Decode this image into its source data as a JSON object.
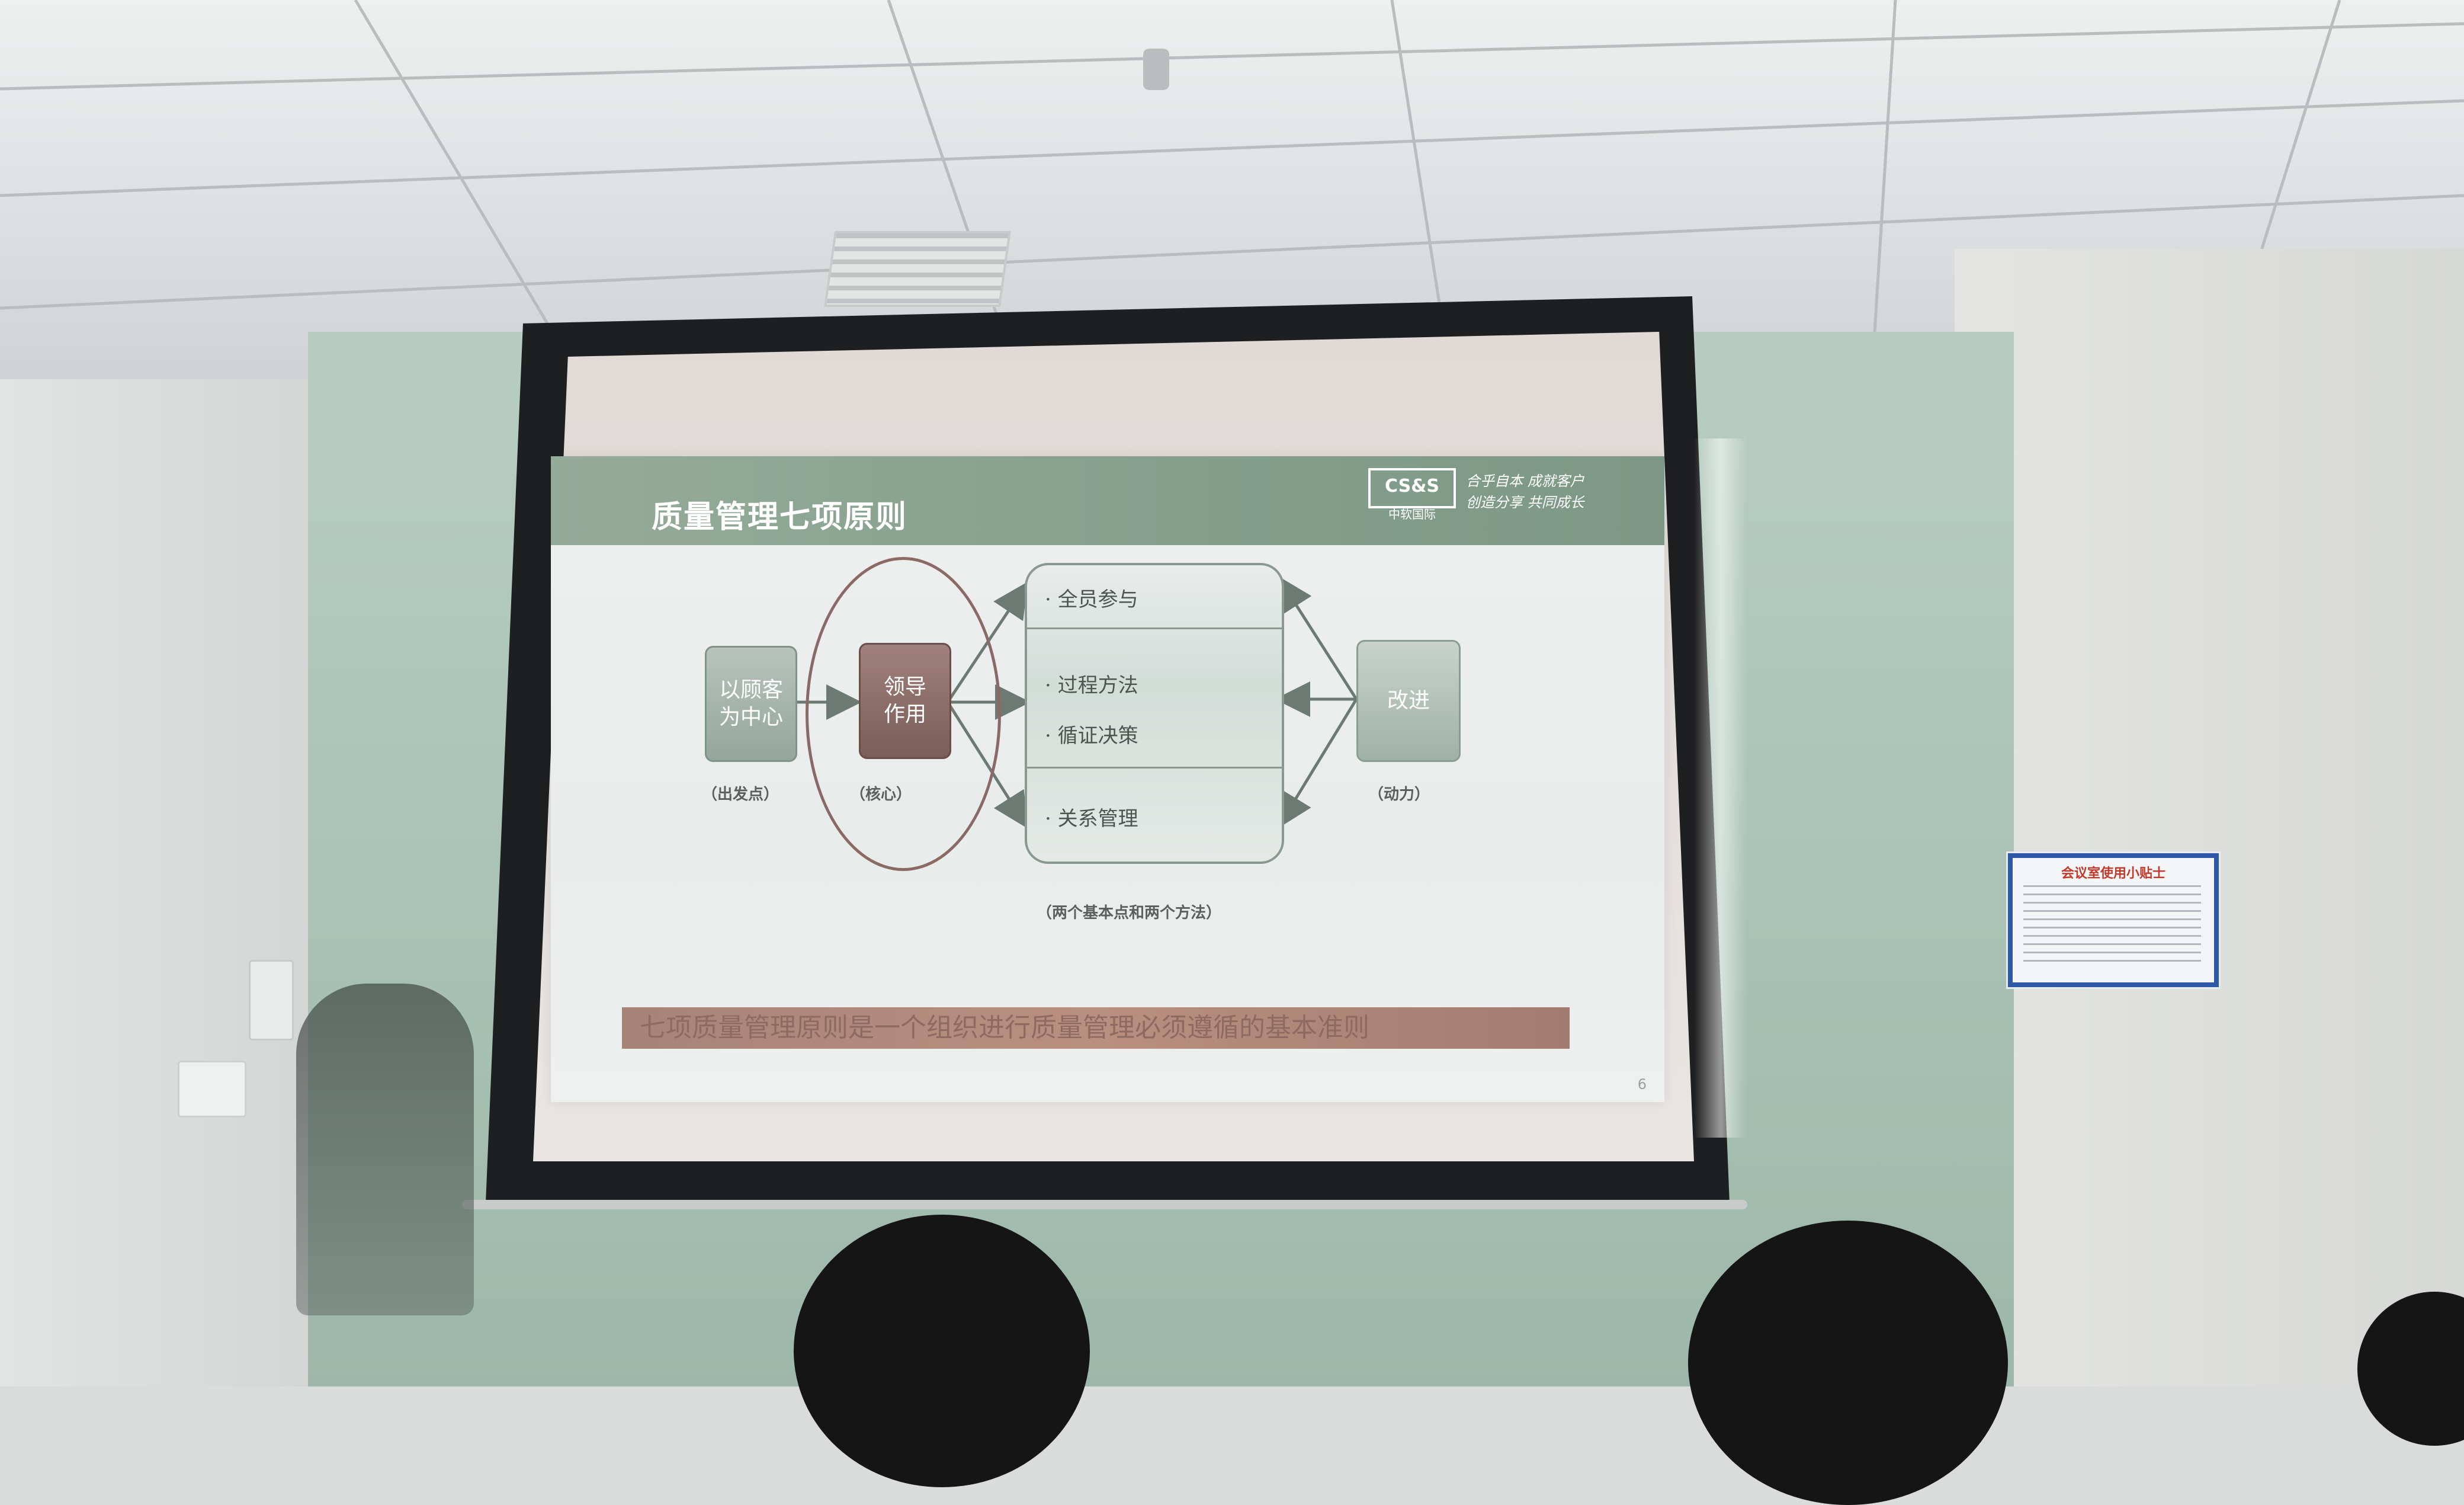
{
  "slide": {
    "title": "质量管理七项原则",
    "logo": {
      "box_text": "CS&S",
      "sub_text": "中软国际",
      "slogan_line1": "合乎自本 成就客户",
      "slogan_line2": "创造分享 共同成长"
    },
    "diagram": {
      "box_customer": "以顾客\n为中心",
      "box_leader": "领导\n作用",
      "box_improve": "改进",
      "panel_items": [
        "· 全员参与",
        "· 过程方法",
        "· 循证决策",
        "· 关系管理"
      ],
      "captions": {
        "start": "（出发点）",
        "core": "（核心）",
        "drive": "（动力）",
        "bottom": "（两个基本点和两个方法）"
      }
    },
    "bottom_bar": "七项质量管理原则是一个组织进行质量管理必须遵循的基本准则",
    "page_number": "6"
  },
  "poster": {
    "title": "会议室使用小贴士"
  },
  "colors": {
    "slide_header": "#839f8c",
    "leader_box": "#7b5d58",
    "poster_border": "#2c58a6"
  }
}
